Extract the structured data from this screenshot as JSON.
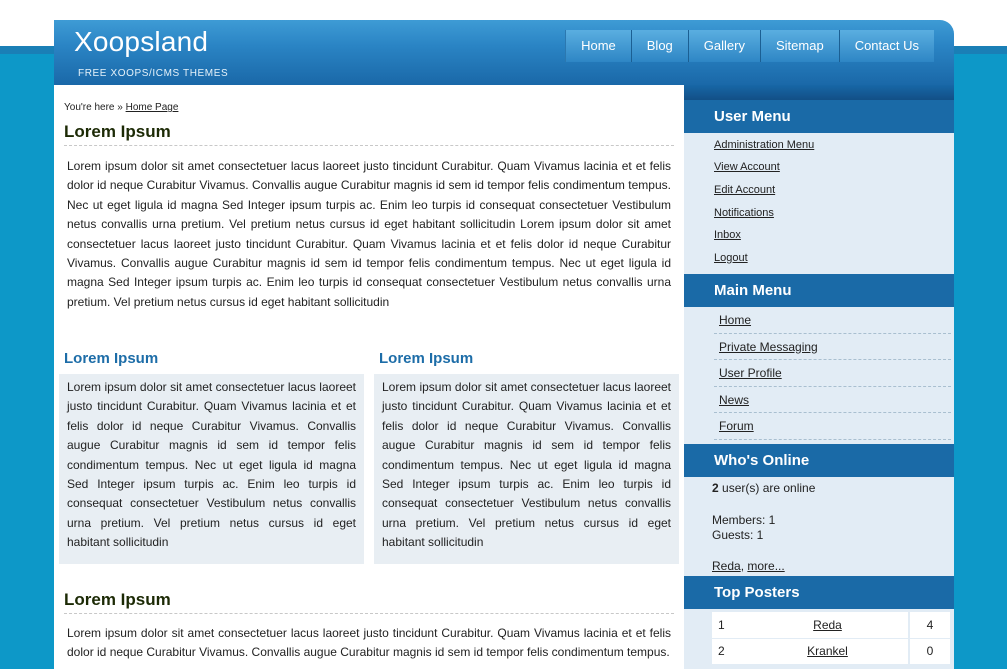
{
  "site": {
    "title": "Xoopsland",
    "tagline": "FREE XOOPS/ICMS THEMES"
  },
  "nav": [
    "Home",
    "Blog",
    "Gallery",
    "Sitemap",
    "Contact Us"
  ],
  "breadcrumb": {
    "prefix": "You're here »",
    "link": "Home Page"
  },
  "main": {
    "heading1": "Lorem Ipsum",
    "para1": "Lorem ipsum dolor sit amet consectetuer lacus laoreet justo tincidunt Curabitur. Quam Vivamus lacinia et et felis dolor id neque Curabitur Vivamus. Convallis augue Curabitur magnis id sem id tempor felis condimentum tempus. Nec ut eget ligula id magna Sed Integer ipsum turpis ac. Enim leo turpis id consequat consectetuer Vestibulum netus convallis urna pretium. Vel pretium netus cursus id eget habitant sollicitudin Lorem ipsum dolor sit amet consectetuer lacus laoreet justo tincidunt Curabitur. Quam Vivamus lacinia et et felis dolor id neque Curabitur Vivamus. Convallis augue Curabitur magnis id sem id tempor felis condimentum tempus. Nec ut eget ligula id magna Sed Integer ipsum turpis ac. Enim leo turpis id consequat consectetuer Vestibulum netus convallis urna pretium. Vel pretium netus cursus id eget habitant sollicitudin",
    "col_left": {
      "title": "Lorem Ipsum",
      "text": "Lorem ipsum dolor sit amet consectetuer lacus laoreet justo tincidunt Curabitur. Quam Vivamus lacinia et et felis dolor id neque Curabitur Vivamus. Convallis augue Curabitur magnis id sem id tempor felis condimentum tempus. Nec ut eget ligula id magna Sed Integer ipsum turpis ac. Enim leo turpis id consequat consectetuer Vestibulum netus convallis urna pretium. Vel pretium netus cursus id eget habitant sollicitudin"
    },
    "col_right": {
      "title": "Lorem Ipsum",
      "text": "Lorem ipsum dolor sit amet consectetuer lacus laoreet justo tincidunt Curabitur. Quam Vivamus lacinia et et felis dolor id neque Curabitur Vivamus. Convallis augue Curabitur magnis id sem id tempor felis condimentum tempus. Nec ut eget ligula id magna Sed Integer ipsum turpis ac. Enim leo turpis id consequat consectetuer Vestibulum netus convallis urna pretium. Vel pretium netus cursus id eget habitant sollicitudin"
    },
    "heading2": "Lorem Ipsum",
    "para2": "Lorem ipsum dolor sit amet consectetuer lacus laoreet justo tincidunt Curabitur. Quam Vivamus lacinia et et felis dolor id neque Curabitur Vivamus. Convallis augue Curabitur magnis id sem id tempor felis condimentum tempus."
  },
  "sidebar": {
    "user_menu": {
      "title": "User Menu",
      "items": [
        "Administration Menu",
        "View Account",
        "Edit Account",
        "Notifications",
        "Inbox",
        "Logout"
      ]
    },
    "main_menu": {
      "title": "Main Menu",
      "items": [
        "Home",
        "Private Messaging",
        "User Profile",
        "News",
        "Forum"
      ]
    },
    "whos_online": {
      "title": "Who's Online",
      "online_count": "2",
      "online_suffix": "user(s) are online",
      "members": "Members: 1",
      "guests": "Guests: 1",
      "user_link": "Reda",
      "more_link": "more..."
    },
    "top_posters": {
      "title": "Top Posters",
      "rows": [
        {
          "rank": "1",
          "name": "Reda",
          "count": "4"
        },
        {
          "rank": "2",
          "name": "Krankel",
          "count": "0"
        }
      ]
    }
  },
  "colors": {
    "accent_blue": "#1a6aa7",
    "page_background": "#0d98c8",
    "heading_dark": "#1c2a05",
    "subheading_blue": "#1d6da8"
  }
}
